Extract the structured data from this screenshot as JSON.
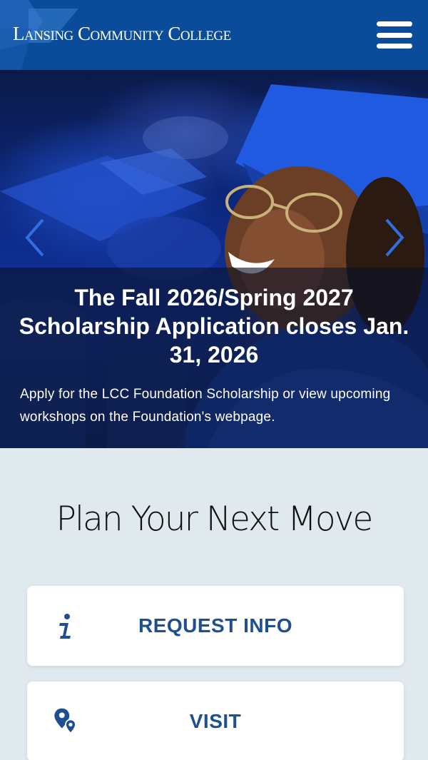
{
  "header": {
    "brand": "Lansing Community College",
    "logo_icon": "lcc-logo-mark-icon",
    "menu_icon": "hamburger-menu-icon",
    "background": "#0a4c9a"
  },
  "hero": {
    "headline": "The Fall 2026/Spring 2027 Scholarship Application closes Jan. 31, 2026",
    "body": "Apply for the LCC Foundation Scholarship or view upcoming workshops on the Foundation's webpage.",
    "prev_icon": "chevron-left-icon",
    "next_icon": "chevron-right-icon"
  },
  "plan": {
    "title": "Plan Your Next Move",
    "buttons": [
      {
        "label": "REQUEST INFO",
        "icon": "info-icon"
      },
      {
        "label": "VISIT",
        "icon": "map-pin-icon"
      }
    ],
    "accent": "#1d4f91"
  }
}
